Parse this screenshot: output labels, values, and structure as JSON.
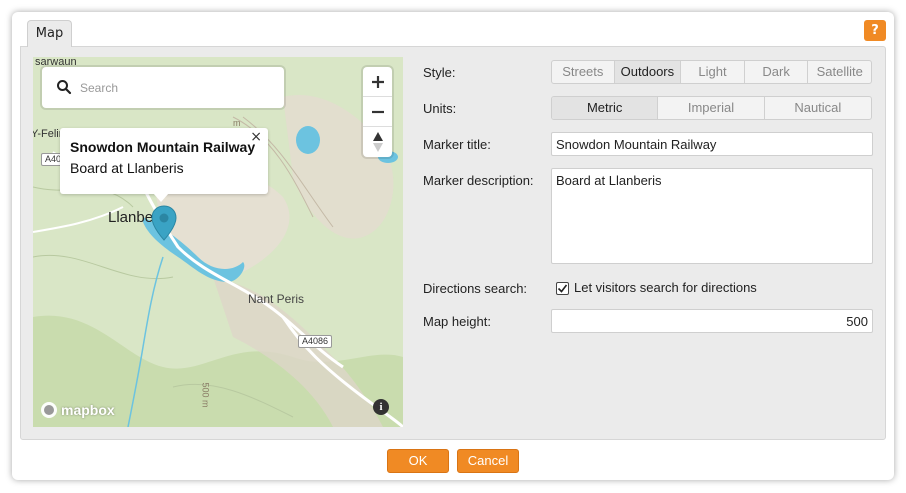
{
  "dialog": {
    "tab_label": "Map",
    "help_label": "?",
    "ok_label": "OK",
    "cancel_label": "Cancel",
    "accent_color": "#f08a24"
  },
  "map": {
    "search_placeholder": "Search",
    "zoom_in_icon": "plus-icon",
    "zoom_out_icon": "minus-icon",
    "compass_icon": "compass-icon",
    "popup": {
      "title": "Snowdon Mountain Railway",
      "description": "Board at Llanberis",
      "close": "×"
    },
    "labels": {
      "sarwaun": "sarwaun",
      "y_felin": "Y-Felin",
      "llanberis": "Llanber",
      "nant_peris": "Nant Peris",
      "a4086": "A4086",
      "a40": "A40",
      "contour_500": "500 m",
      "contour_m": "m"
    },
    "attribution": "mapbox",
    "info_label": "i",
    "marker_color": "#3aa3c4"
  },
  "form": {
    "style": {
      "label": "Style:",
      "options": [
        "Streets",
        "Outdoors",
        "Light",
        "Dark",
        "Satellite"
      ],
      "selected": "Outdoors"
    },
    "units": {
      "label": "Units:",
      "options": [
        "Metric",
        "Imperial",
        "Nautical"
      ],
      "selected": "Metric"
    },
    "marker_title": {
      "label": "Marker title:",
      "value": "Snowdon Mountain Railway"
    },
    "marker_description": {
      "label": "Marker description:",
      "value": "Board at Llanberis"
    },
    "directions_search": {
      "label": "Directions search:",
      "checkbox_label": "Let visitors search for directions",
      "checked": true
    },
    "map_height": {
      "label": "Map height:",
      "value": "500"
    }
  }
}
